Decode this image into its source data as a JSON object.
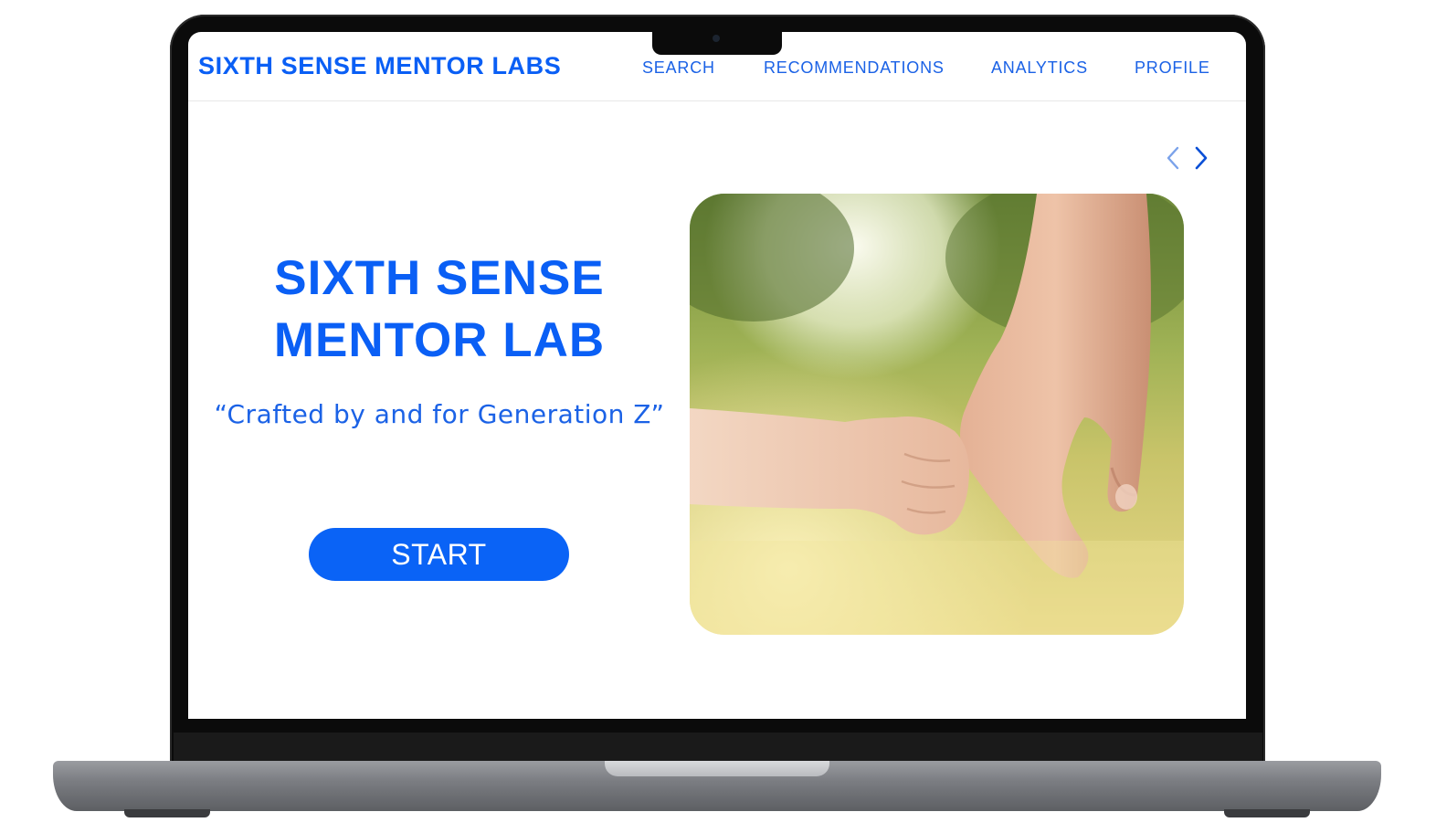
{
  "nav": {
    "brand": "SIXTH SENSE MENTOR LABS",
    "links": [
      {
        "label": "SEARCH"
      },
      {
        "label": "RECOMMENDATIONS"
      },
      {
        "label": "ANALYTICS"
      },
      {
        "label": "PROFILE"
      }
    ]
  },
  "carousel": {
    "prev_icon": "chevron-left-icon",
    "next_icon": "chevron-right-icon"
  },
  "hero": {
    "title_line1": "SIXTH SENSE",
    "title_line2": "MENTOR LAB",
    "tagline": "“Crafted by and for Generation Z”",
    "start_label": "START",
    "image": "photo of a child's hand holding an adult's finger in a sunny meadow"
  },
  "colors": {
    "accent": "#0a5ff5",
    "link": "#1b62e6",
    "button": "#0a63f6",
    "button_text": "#ffffff"
  }
}
